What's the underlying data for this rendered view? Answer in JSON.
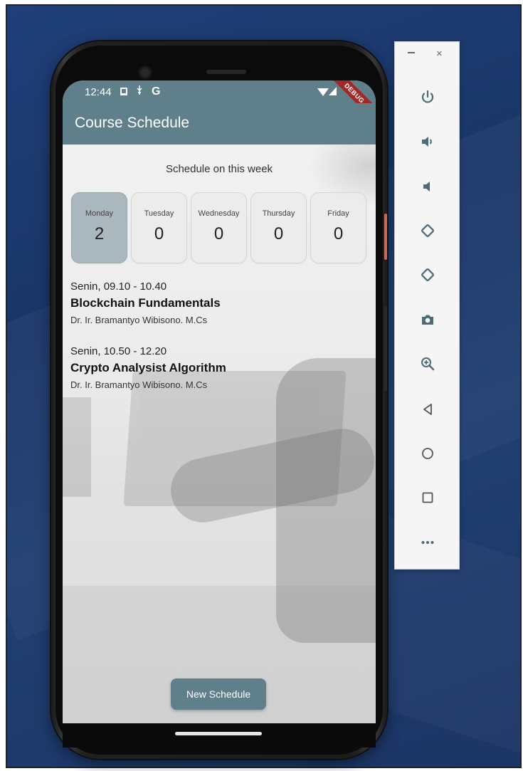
{
  "status_bar": {
    "time": "12:44",
    "icons": [
      "notification-icon",
      "usb-icon",
      "google-icon",
      "wifi-icon",
      "signal-icon"
    ],
    "google_glyph": "G",
    "debug_banner": "DEBUG"
  },
  "app_bar": {
    "title": "Course Schedule",
    "color": "#5f7f8a"
  },
  "schedule": {
    "heading": "Schedule on this week",
    "days": [
      {
        "name": "Monday",
        "count": "2",
        "selected": true
      },
      {
        "name": "Tuesday",
        "count": "0",
        "selected": false
      },
      {
        "name": "Wednesday",
        "count": "0",
        "selected": false
      },
      {
        "name": "Thursday",
        "count": "0",
        "selected": false
      },
      {
        "name": "Friday",
        "count": "0",
        "selected": false
      }
    ],
    "courses": [
      {
        "time": "Senin, 09.10 - 10.40",
        "title": "Blockchain Fundamentals",
        "lecturer": "Dr. Ir. Bramantyo Wibisono. M.Cs"
      },
      {
        "time": "Senin, 10.50 - 12.20",
        "title": "Crypto Analysist Algorithm",
        "lecturer": "Dr. Ir. Bramantyo Wibisono. M.Cs"
      }
    ]
  },
  "new_schedule_button": {
    "label": "New Schedule"
  },
  "emulator_panel": {
    "window_controls": {
      "minimize": "–",
      "close": "×"
    },
    "buttons": [
      "power-icon",
      "volume-up-icon",
      "volume-down-icon",
      "rotate-left-icon",
      "rotate-right-icon",
      "screenshot-icon",
      "zoom-icon",
      "back-icon",
      "home-icon",
      "overview-icon",
      "more-icon"
    ]
  }
}
